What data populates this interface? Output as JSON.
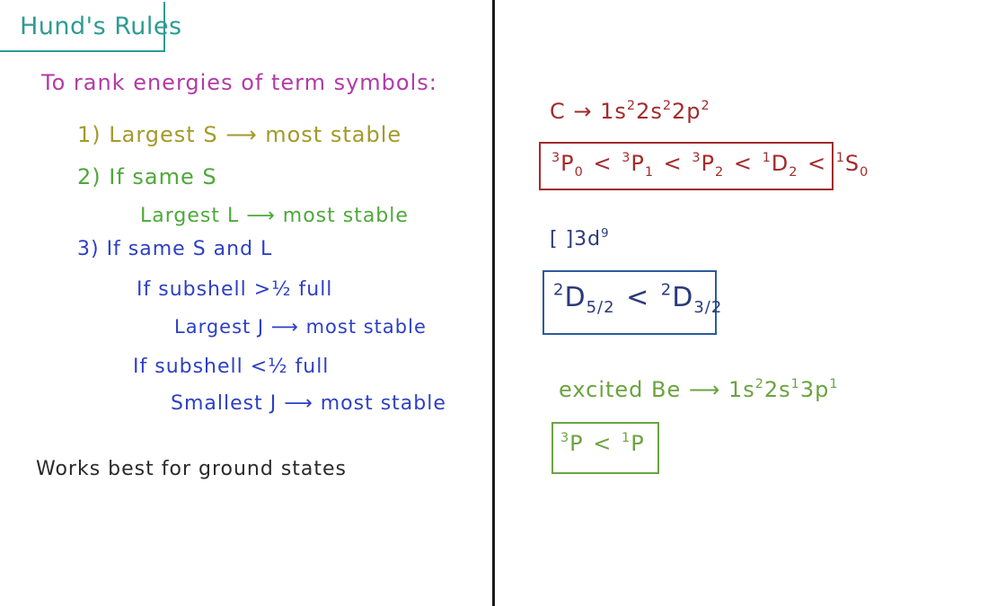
{
  "title": "Hund's Rules",
  "intro": "To rank energies of term symbols:",
  "rules": {
    "r1": "1) Largest S ⟶ most stable",
    "r2": "2) If same S",
    "r2a": "Largest L ⟶ most stable",
    "r3": "3) If same S and L",
    "r3a": "If subshell >½ full",
    "r3b": "Largest J ⟶ most stable",
    "r3c": "If subshell <½ full",
    "r3d": "Smallest J ⟶ most stable"
  },
  "note": "Works best for ground states",
  "examples": {
    "carbon": {
      "label": "C →",
      "config_1s": "1s",
      "config_1s_e": "2",
      "config_2s": "2s",
      "config_2s_e": "2",
      "config_2p": "2p",
      "config_2p_e": "2",
      "terms": [
        {
          "mult": "3",
          "L": "P",
          "J": "0"
        },
        {
          "mult": "3",
          "L": "P",
          "J": "1"
        },
        {
          "mult": "3",
          "L": "P",
          "J": "2"
        },
        {
          "mult": "1",
          "L": "D",
          "J": "2"
        },
        {
          "mult": "1",
          "L": "S",
          "J": "0"
        }
      ],
      "sep": "<"
    },
    "d9": {
      "label": "[ ]3d",
      "label_e": "9",
      "terms": [
        {
          "mult": "2",
          "L": "D",
          "J": "5/2"
        },
        {
          "mult": "2",
          "L": "D",
          "J": "3/2"
        }
      ],
      "sep": "<"
    },
    "be": {
      "label": "excited Be ⟶",
      "config_1s": "1s",
      "config_1s_e": "2",
      "config_2s": "2s",
      "config_2s_e": "1",
      "config_3p": "3p",
      "config_3p_e": "1",
      "terms": [
        {
          "mult": "3",
          "L": "P"
        },
        {
          "mult": "1",
          "L": "P"
        }
      ],
      "sep": "<"
    }
  }
}
